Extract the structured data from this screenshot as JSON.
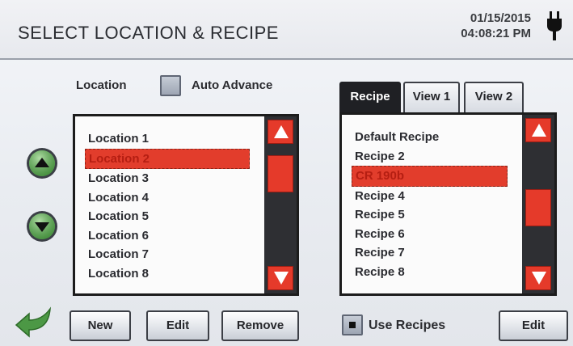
{
  "header": {
    "title": "SELECT LOCATION & RECIPE",
    "date": "01/15/2015",
    "time": "04:08:21 PM",
    "power_icon": "power-plug-icon"
  },
  "location": {
    "label": "Location",
    "auto_advance_label": "Auto Advance",
    "auto_advance_checked": false,
    "items": [
      "Location 1",
      "Location 2",
      "Location 3",
      "Location 4",
      "Location 5",
      "Location 6",
      "Location 7",
      "Location 8"
    ],
    "selected_index": 1
  },
  "recipe": {
    "tabs": [
      "Recipe",
      "View 1",
      "View 2"
    ],
    "active_tab": 0,
    "items": [
      "Default Recipe",
      "Recipe 2",
      "CR 190b",
      "Recipe 4",
      "Recipe 5",
      "Recipe 6",
      "Recipe 7",
      "Recipe 8"
    ],
    "selected_index": 2
  },
  "buttons": {
    "new": "New",
    "edit_location": "Edit",
    "remove": "Remove",
    "use_recipes": "Use Recipes",
    "use_recipes_checked": true,
    "edit_recipe": "Edit"
  },
  "icons": {
    "up": "up-arrow-icon",
    "down": "down-arrow-icon",
    "back": "back-arrow-icon"
  },
  "colors": {
    "selection": "#e23d2c",
    "scroll_button": "#e53a2a",
    "round_button": "#4f9a45",
    "back_arrow": "#3f8a3a"
  }
}
